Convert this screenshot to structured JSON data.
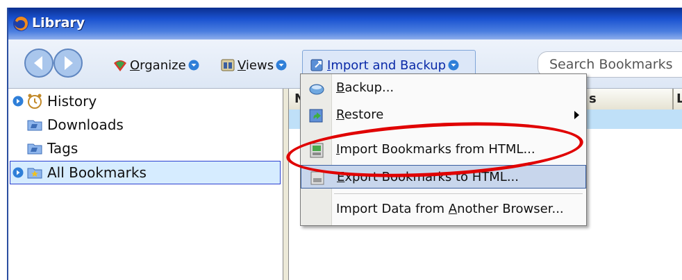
{
  "window": {
    "title": "Library",
    "accent_title_bar": "#1a52d0"
  },
  "toolbar": {
    "back_icon": "back-arrow-icon",
    "forward_icon": "forward-arrow-icon",
    "organize": {
      "label_first": "O",
      "label_rest": "rganize"
    },
    "views": {
      "label_first": "V",
      "label_rest": "iews"
    },
    "import_backup": {
      "label_first": "I",
      "label_rest": "mport and Backup"
    },
    "search_placeholder": "Search Bookmarks"
  },
  "sidebar": {
    "items": [
      {
        "label": "History",
        "icon": "clock-icon"
      },
      {
        "label": "Downloads",
        "icon": "folder-icon"
      },
      {
        "label": "Tags",
        "icon": "folder-icon"
      },
      {
        "label": "All Bookmarks",
        "icon": "star-folder-icon"
      }
    ]
  },
  "content": {
    "columns": [
      "N",
      "s",
      "L"
    ]
  },
  "menu": {
    "items": [
      {
        "first": "B",
        "rest": "ackup...",
        "icon": "backup-icon"
      },
      {
        "first": "R",
        "rest": "estore",
        "icon": "restore-icon",
        "submenu": true
      },
      {
        "pre": "",
        "first": "I",
        "rest": "mport Bookmarks from HTML...",
        "icon": "import-html-icon"
      },
      {
        "pre": "",
        "first": "E",
        "rest": "xport Bookmarks to HTML...",
        "icon": "export-html-icon"
      },
      {
        "pre": "Import Data from ",
        "first": "A",
        "rest": "nother Browser..."
      }
    ]
  },
  "annotation": {
    "color": "#e00000"
  }
}
